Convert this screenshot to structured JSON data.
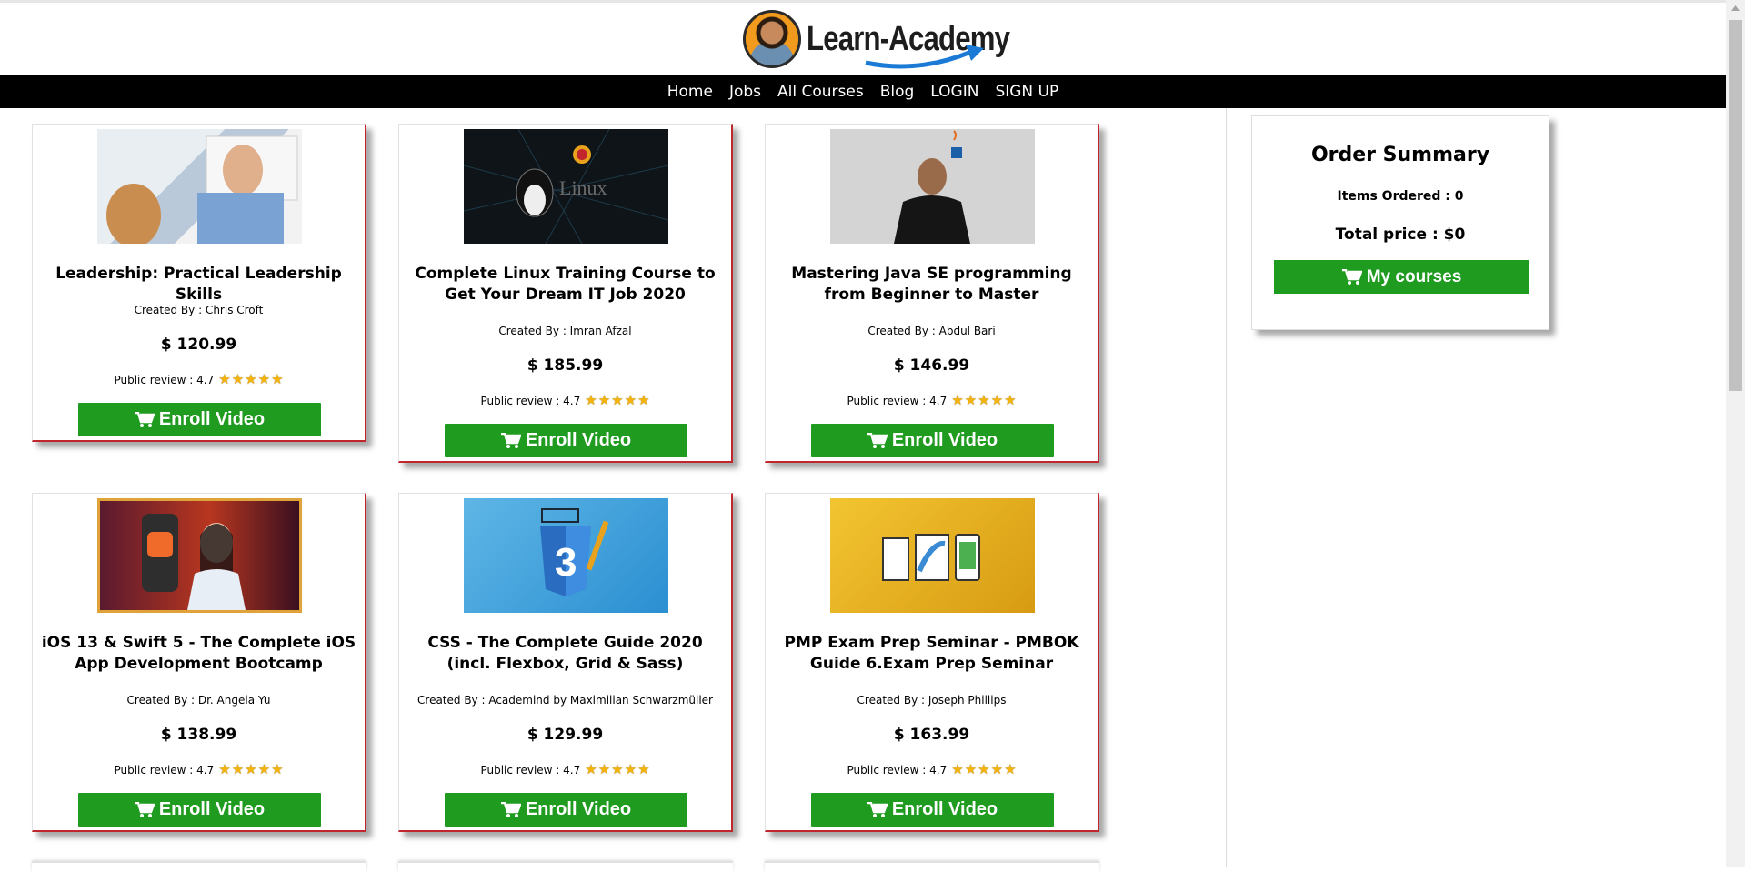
{
  "site": {
    "logo_text": "Learn-Academy"
  },
  "nav": [
    "Home",
    "Jobs",
    "All Courses",
    "Blog",
    "LOGIN",
    "SIGN UP"
  ],
  "courses": [
    {
      "title": "Leadership: Practical Leadership Skills",
      "author": "Created By : Chris Croft",
      "price": "$ 120.99",
      "review": "Public review : 4.7",
      "rating": 5,
      "button": "Enroll Video",
      "image": "leadership-presenter-whiteboard"
    },
    {
      "title": "Complete Linux Training Course to Get Your Dream IT Job 2020",
      "author": "Created By : Imran Afzal",
      "price": "$ 185.99",
      "review": "Public review : 4.7",
      "rating": 5,
      "button": "Enroll Video",
      "image": "linux-penguin-badge"
    },
    {
      "title": "Mastering Java SE programming from Beginner to Master",
      "author": "Created By : Abdul Bari",
      "price": "$ 146.99",
      "review": "Public review : 4.7",
      "rating": 5,
      "button": "Enroll Video",
      "image": "java-instructor"
    },
    {
      "title": "iOS 13 & Swift 5 - The Complete iOS App Development Bootcamp",
      "author": "Created By : Dr. Angela Yu",
      "price": "$ 138.99",
      "review": "Public review : 4.7",
      "rating": 5,
      "button": "Enroll Video",
      "image": "ios-swift-instructor"
    },
    {
      "title": "CSS - The Complete Guide 2020 (incl. Flexbox, Grid & Sass)",
      "author": "Created By : Academind by Maximilian Schwarzmüller",
      "price": "$ 129.99",
      "review": "Public review : 4.7",
      "rating": 5,
      "button": "Enroll Video",
      "image": "css3-logo"
    },
    {
      "title": "PMP Exam Prep Seminar - PMBOK Guide 6.Exam Prep Seminar",
      "author": "Created By : Joseph Phillips",
      "price": "$ 163.99",
      "review": "Public review : 4.7",
      "rating": 5,
      "button": "Enroll Video",
      "image": "pmp-devices"
    }
  ],
  "summary": {
    "title": "Order Summary",
    "items": "Items Ordered : 0",
    "total": "Total price : $0",
    "button": "My courses"
  },
  "colors": {
    "nav_bg": "#000000",
    "button_green": "#1f9b1f",
    "card_accent": "#c0262c",
    "star": "#f5b40a"
  }
}
